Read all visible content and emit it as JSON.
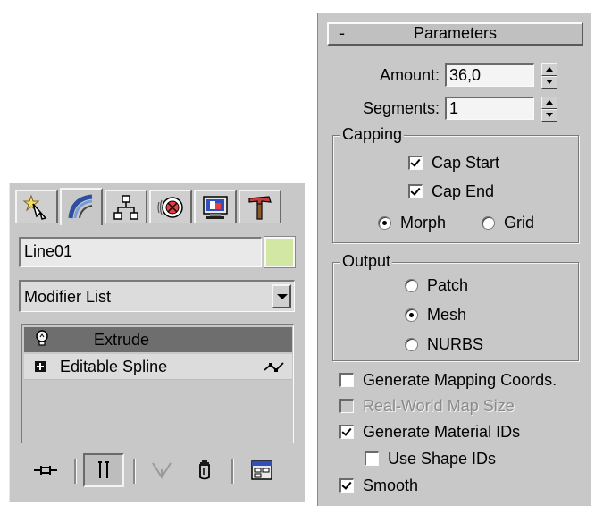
{
  "command_panel": {
    "tabs": [
      {
        "icon": "create-icon"
      },
      {
        "icon": "modify-icon"
      },
      {
        "icon": "hierarchy-icon"
      },
      {
        "icon": "motion-icon"
      },
      {
        "icon": "display-icon"
      },
      {
        "icon": "utilities-icon"
      }
    ],
    "object_name": "Line01",
    "object_color": "#d3e7a4",
    "modifier_list": "Modifier List",
    "stack": [
      {
        "label": "Extrude",
        "selected": true
      },
      {
        "label": "Editable Spline",
        "selected": false
      }
    ]
  },
  "parameters": {
    "rollout_minus": "-",
    "rollout_title": "Parameters",
    "amount_label": "Amount:",
    "amount_value": "36,0",
    "segments_label": "Segments:",
    "segments_value": "1",
    "capping": {
      "title": "Capping",
      "cap_start": "Cap Start",
      "cap_end": "Cap End",
      "morph": "Morph",
      "grid": "Grid"
    },
    "output": {
      "title": "Output",
      "patch": "Patch",
      "mesh": "Mesh",
      "nurbs": "NURBS"
    },
    "gen_mapping": "Generate Mapping Coords.",
    "real_world": "Real-World Map Size",
    "gen_material_ids": "Generate Material IDs",
    "use_shape_ids": "Use Shape IDs",
    "smooth": "Smooth"
  }
}
